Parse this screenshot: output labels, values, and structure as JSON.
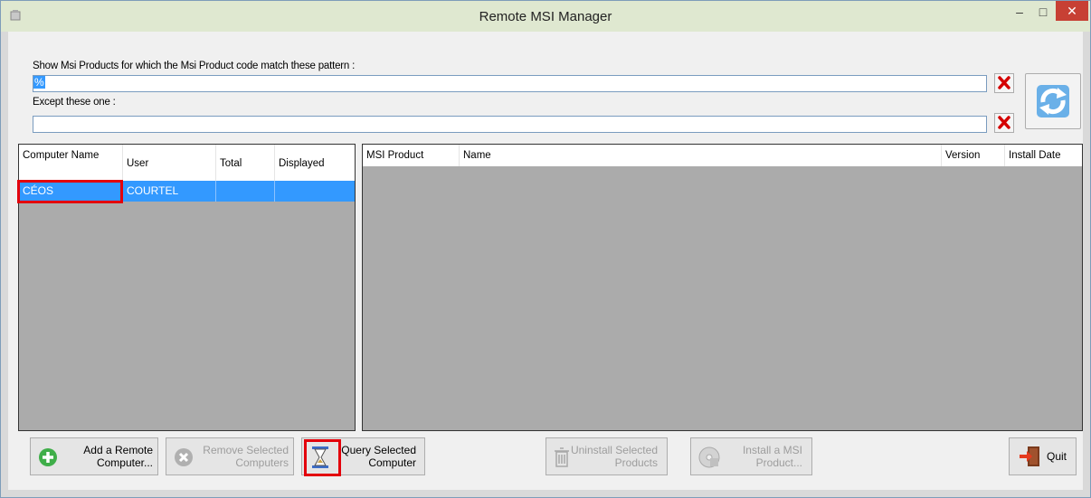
{
  "window": {
    "title": "Remote MSI Manager",
    "minimize_glyph": "–",
    "maximize_glyph": "□",
    "close_glyph": "✕"
  },
  "filters": {
    "include_label": "Show Msi Products for which the Msi Product code match these pattern :",
    "include_value": "%",
    "except_label": "Except these one :",
    "except_value": ""
  },
  "computers": {
    "columns": [
      "Computer Name",
      "User",
      "Total",
      "Displayed"
    ],
    "rows": [
      {
        "computer": "CÉOS",
        "user": "COURTEL",
        "total": "",
        "displayed": ""
      }
    ]
  },
  "products": {
    "columns": [
      "MSI Product",
      "Name",
      "Version",
      "Install Date"
    ]
  },
  "buttons": {
    "add": "Add a Remote Computer...",
    "remove": "Remove Selected Computers",
    "query": "Query Selected Computer",
    "uninstall": "Uninstall Selected Products",
    "install": "Install a MSI Product...",
    "quit": "Quit"
  },
  "icons": {
    "clear_include": "red-x-icon",
    "clear_except": "red-x-icon",
    "refresh": "refresh-arrows-icon",
    "add": "plus-circle-icon",
    "remove": "x-circle-icon",
    "query": "hourglass-icon",
    "uninstall": "trash-icon",
    "install": "cd-install-icon",
    "quit": "exit-door-icon"
  },
  "colors": {
    "selection": "#3399ff",
    "highlight_box": "#e3000b",
    "close_button": "#c74034"
  }
}
